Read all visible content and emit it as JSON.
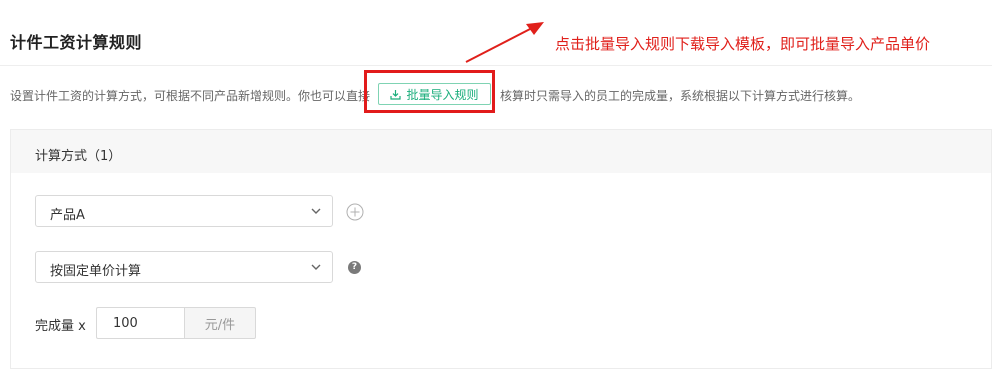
{
  "page": {
    "title": "计件工资计算规则",
    "annotation": "点击批量导入规则下载导入模板，即可批量导入产品单价",
    "description": {
      "before": "设置计件工资的计算方式，可根据不同产品新增规则。你也可以直接",
      "after": "核算时只需导入的员工的完成量，系统根据以下计算方式进行核算。"
    },
    "import_button": {
      "label": "批量导入规则",
      "icon": "download-icon"
    }
  },
  "section": {
    "title": "计算方式（1）",
    "product_select": {
      "value": "产品A",
      "icon": "chevron-down-icon"
    },
    "method_select": {
      "value": "按固定单价计算",
      "icon": "chevron-down-icon"
    },
    "help": {
      "icon": "question-icon",
      "glyph": "?"
    },
    "add": {
      "icon": "plus-circle-icon"
    },
    "quantity": {
      "label": "完成量 x",
      "value": "100",
      "unit": "元/件"
    }
  },
  "colors": {
    "accent_green": "#1aad7b",
    "annotation_red": "#e0201b"
  }
}
